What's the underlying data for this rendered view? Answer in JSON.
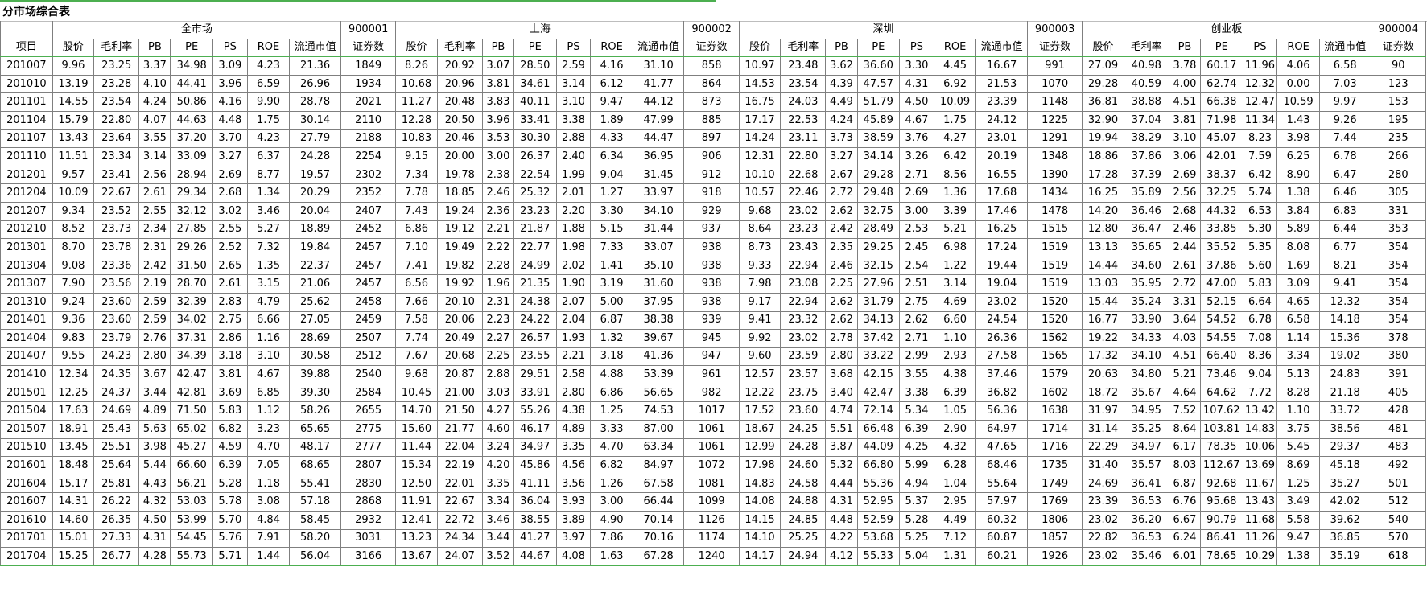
{
  "title": "分市场综合表",
  "groups": [
    {
      "name": "全市场",
      "code": "900001"
    },
    {
      "name": "上海",
      "code": "900002"
    },
    {
      "name": "深圳",
      "code": "900003"
    },
    {
      "name": "创业板",
      "code": "900004"
    }
  ],
  "row_header": "项目",
  "columns": [
    "股价",
    "毛利率",
    "PB",
    "PE",
    "PS",
    "ROE",
    "流通市值",
    "证券数"
  ],
  "rows": [
    [
      "201007",
      "9.96",
      "23.25",
      "3.37",
      "34.98",
      "3.09",
      "4.23",
      "21.36",
      "1849",
      "8.26",
      "20.92",
      "3.07",
      "28.50",
      "2.59",
      "4.16",
      "31.10",
      "858",
      "10.97",
      "23.48",
      "3.62",
      "36.60",
      "3.30",
      "4.45",
      "16.67",
      "991",
      "27.09",
      "40.98",
      "3.78",
      "60.17",
      "11.96",
      "4.06",
      "6.58",
      "90"
    ],
    [
      "201010",
      "13.19",
      "23.28",
      "4.10",
      "44.41",
      "3.96",
      "6.59",
      "26.96",
      "1934",
      "10.68",
      "20.96",
      "3.81",
      "34.61",
      "3.14",
      "6.12",
      "41.77",
      "864",
      "14.53",
      "23.54",
      "4.39",
      "47.57",
      "4.31",
      "6.92",
      "21.53",
      "1070",
      "29.28",
      "40.59",
      "4.00",
      "62.74",
      "12.32",
      "0.00",
      "7.03",
      "123"
    ],
    [
      "201101",
      "14.55",
      "23.54",
      "4.24",
      "50.86",
      "4.16",
      "9.90",
      "28.78",
      "2021",
      "11.27",
      "20.48",
      "3.83",
      "40.11",
      "3.10",
      "9.47",
      "44.12",
      "873",
      "16.75",
      "24.03",
      "4.49",
      "51.79",
      "4.50",
      "10.09",
      "23.39",
      "1148",
      "36.81",
      "38.88",
      "4.51",
      "66.38",
      "12.47",
      "10.59",
      "9.97",
      "153"
    ],
    [
      "201104",
      "15.79",
      "22.80",
      "4.07",
      "44.63",
      "4.48",
      "1.75",
      "30.14",
      "2110",
      "12.28",
      "20.50",
      "3.96",
      "33.41",
      "3.38",
      "1.89",
      "47.99",
      "885",
      "17.17",
      "22.53",
      "4.24",
      "45.89",
      "4.67",
      "1.75",
      "24.12",
      "1225",
      "32.90",
      "37.04",
      "3.81",
      "71.98",
      "11.34",
      "1.43",
      "9.26",
      "195"
    ],
    [
      "201107",
      "13.43",
      "23.64",
      "3.55",
      "37.20",
      "3.70",
      "4.23",
      "27.79",
      "2188",
      "10.83",
      "20.46",
      "3.53",
      "30.30",
      "2.88",
      "4.33",
      "44.47",
      "897",
      "14.24",
      "23.11",
      "3.73",
      "38.59",
      "3.76",
      "4.27",
      "23.01",
      "1291",
      "19.94",
      "38.29",
      "3.10",
      "45.07",
      "8.23",
      "3.98",
      "7.44",
      "235"
    ],
    [
      "201110",
      "11.51",
      "23.34",
      "3.14",
      "33.09",
      "3.27",
      "6.37",
      "24.28",
      "2254",
      "9.15",
      "20.00",
      "3.00",
      "26.37",
      "2.40",
      "6.34",
      "36.95",
      "906",
      "12.31",
      "22.80",
      "3.27",
      "34.14",
      "3.26",
      "6.42",
      "20.19",
      "1348",
      "18.86",
      "37.86",
      "3.06",
      "42.01",
      "7.59",
      "6.25",
      "6.78",
      "266"
    ],
    [
      "201201",
      "9.57",
      "23.41",
      "2.56",
      "28.94",
      "2.69",
      "8.77",
      "19.57",
      "2302",
      "7.34",
      "19.78",
      "2.38",
      "22.54",
      "1.99",
      "9.04",
      "31.45",
      "912",
      "10.10",
      "22.68",
      "2.67",
      "29.28",
      "2.71",
      "8.56",
      "16.55",
      "1390",
      "17.28",
      "37.39",
      "2.69",
      "38.37",
      "6.42",
      "8.90",
      "6.47",
      "280"
    ],
    [
      "201204",
      "10.09",
      "22.67",
      "2.61",
      "29.34",
      "2.68",
      "1.34",
      "20.29",
      "2352",
      "7.78",
      "18.85",
      "2.46",
      "25.32",
      "2.01",
      "1.27",
      "33.97",
      "918",
      "10.57",
      "22.46",
      "2.72",
      "29.48",
      "2.69",
      "1.36",
      "17.68",
      "1434",
      "16.25",
      "35.89",
      "2.56",
      "32.25",
      "5.74",
      "1.38",
      "6.46",
      "305"
    ],
    [
      "201207",
      "9.34",
      "23.52",
      "2.55",
      "32.12",
      "3.02",
      "3.46",
      "20.04",
      "2407",
      "7.43",
      "19.24",
      "2.36",
      "23.23",
      "2.20",
      "3.30",
      "34.10",
      "929",
      "9.68",
      "23.02",
      "2.62",
      "32.75",
      "3.00",
      "3.39",
      "17.46",
      "1478",
      "14.20",
      "36.46",
      "2.68",
      "44.32",
      "6.53",
      "3.84",
      "6.83",
      "331"
    ],
    [
      "201210",
      "8.52",
      "23.73",
      "2.34",
      "27.85",
      "2.55",
      "5.27",
      "18.89",
      "2452",
      "6.86",
      "19.12",
      "2.21",
      "21.87",
      "1.88",
      "5.15",
      "31.44",
      "937",
      "8.64",
      "23.23",
      "2.42",
      "28.49",
      "2.53",
      "5.21",
      "16.25",
      "1515",
      "12.80",
      "36.47",
      "2.46",
      "33.85",
      "5.30",
      "5.89",
      "6.44",
      "353"
    ],
    [
      "201301",
      "8.70",
      "23.78",
      "2.31",
      "29.26",
      "2.52",
      "7.32",
      "19.84",
      "2457",
      "7.10",
      "19.49",
      "2.22",
      "22.77",
      "1.98",
      "7.33",
      "33.07",
      "938",
      "8.73",
      "23.43",
      "2.35",
      "29.25",
      "2.45",
      "6.98",
      "17.24",
      "1519",
      "13.13",
      "35.65",
      "2.44",
      "35.52",
      "5.35",
      "8.08",
      "6.77",
      "354"
    ],
    [
      "201304",
      "9.08",
      "23.36",
      "2.42",
      "31.50",
      "2.65",
      "1.35",
      "22.37",
      "2457",
      "7.41",
      "19.82",
      "2.28",
      "24.99",
      "2.02",
      "1.41",
      "35.10",
      "938",
      "9.33",
      "22.94",
      "2.46",
      "32.15",
      "2.54",
      "1.22",
      "19.44",
      "1519",
      "14.44",
      "34.60",
      "2.61",
      "37.86",
      "5.60",
      "1.69",
      "8.21",
      "354"
    ],
    [
      "201307",
      "7.90",
      "23.56",
      "2.19",
      "28.70",
      "2.61",
      "3.15",
      "21.06",
      "2457",
      "6.56",
      "19.92",
      "1.96",
      "21.35",
      "1.90",
      "3.19",
      "31.60",
      "938",
      "7.98",
      "23.08",
      "2.25",
      "27.96",
      "2.51",
      "3.14",
      "19.04",
      "1519",
      "13.03",
      "35.95",
      "2.72",
      "47.00",
      "5.83",
      "3.09",
      "9.41",
      "354"
    ],
    [
      "201310",
      "9.24",
      "23.60",
      "2.59",
      "32.39",
      "2.83",
      "4.79",
      "25.62",
      "2458",
      "7.66",
      "20.10",
      "2.31",
      "24.38",
      "2.07",
      "5.00",
      "37.95",
      "938",
      "9.17",
      "22.94",
      "2.62",
      "31.79",
      "2.75",
      "4.69",
      "23.02",
      "1520",
      "15.44",
      "35.24",
      "3.31",
      "52.15",
      "6.64",
      "4.65",
      "12.32",
      "354"
    ],
    [
      "201401",
      "9.36",
      "23.60",
      "2.59",
      "34.02",
      "2.75",
      "6.66",
      "27.05",
      "2459",
      "7.58",
      "20.06",
      "2.23",
      "24.22",
      "2.04",
      "6.87",
      "38.38",
      "939",
      "9.41",
      "23.32",
      "2.62",
      "34.13",
      "2.62",
      "6.60",
      "24.54",
      "1520",
      "16.77",
      "33.90",
      "3.64",
      "54.52",
      "6.78",
      "6.58",
      "14.18",
      "354"
    ],
    [
      "201404",
      "9.83",
      "23.79",
      "2.76",
      "37.31",
      "2.86",
      "1.16",
      "28.69",
      "2507",
      "7.74",
      "20.49",
      "2.27",
      "26.57",
      "1.93",
      "1.32",
      "39.67",
      "945",
      "9.92",
      "23.02",
      "2.78",
      "37.42",
      "2.71",
      "1.10",
      "26.36",
      "1562",
      "19.22",
      "34.33",
      "4.03",
      "54.55",
      "7.08",
      "1.14",
      "15.36",
      "378"
    ],
    [
      "201407",
      "9.55",
      "24.23",
      "2.80",
      "34.39",
      "3.18",
      "3.10",
      "30.58",
      "2512",
      "7.67",
      "20.68",
      "2.25",
      "23.55",
      "2.21",
      "3.18",
      "41.36",
      "947",
      "9.60",
      "23.59",
      "2.80",
      "33.22",
      "2.99",
      "2.93",
      "27.58",
      "1565",
      "17.32",
      "34.10",
      "4.51",
      "66.40",
      "8.36",
      "3.34",
      "19.02",
      "380"
    ],
    [
      "201410",
      "12.34",
      "24.35",
      "3.67",
      "42.47",
      "3.81",
      "4.67",
      "39.88",
      "2540",
      "9.68",
      "20.87",
      "2.88",
      "29.51",
      "2.58",
      "4.88",
      "53.39",
      "961",
      "12.57",
      "23.57",
      "3.68",
      "42.15",
      "3.55",
      "4.38",
      "37.46",
      "1579",
      "20.63",
      "34.80",
      "5.21",
      "73.46",
      "9.04",
      "5.13",
      "24.83",
      "391"
    ],
    [
      "201501",
      "12.25",
      "24.37",
      "3.44",
      "42.81",
      "3.69",
      "6.85",
      "39.30",
      "2584",
      "10.45",
      "21.00",
      "3.03",
      "33.91",
      "2.80",
      "6.86",
      "56.65",
      "982",
      "12.22",
      "23.75",
      "3.40",
      "42.47",
      "3.38",
      "6.39",
      "36.82",
      "1602",
      "18.72",
      "35.67",
      "4.64",
      "64.62",
      "7.72",
      "8.28",
      "21.18",
      "405"
    ],
    [
      "201504",
      "17.63",
      "24.69",
      "4.89",
      "71.50",
      "5.83",
      "1.12",
      "58.26",
      "2655",
      "14.70",
      "21.50",
      "4.27",
      "55.26",
      "4.38",
      "1.25",
      "74.53",
      "1017",
      "17.52",
      "23.60",
      "4.74",
      "72.14",
      "5.34",
      "1.05",
      "56.36",
      "1638",
      "31.97",
      "34.95",
      "7.52",
      "107.62",
      "13.42",
      "1.10",
      "33.72",
      "428"
    ],
    [
      "201507",
      "18.91",
      "25.43",
      "5.63",
      "65.02",
      "6.82",
      "3.23",
      "65.65",
      "2775",
      "15.60",
      "21.77",
      "4.60",
      "46.17",
      "4.89",
      "3.33",
      "87.00",
      "1061",
      "18.67",
      "24.25",
      "5.51",
      "66.48",
      "6.39",
      "2.90",
      "64.97",
      "1714",
      "31.14",
      "35.25",
      "8.64",
      "103.81",
      "14.83",
      "3.75",
      "38.56",
      "481"
    ],
    [
      "201510",
      "13.45",
      "25.51",
      "3.98",
      "45.27",
      "4.59",
      "4.70",
      "48.17",
      "2777",
      "11.44",
      "22.04",
      "3.24",
      "34.97",
      "3.35",
      "4.70",
      "63.34",
      "1061",
      "12.99",
      "24.28",
      "3.87",
      "44.09",
      "4.25",
      "4.32",
      "47.65",
      "1716",
      "22.29",
      "34.97",
      "6.17",
      "78.35",
      "10.06",
      "5.45",
      "29.37",
      "483"
    ],
    [
      "201601",
      "18.48",
      "25.64",
      "5.44",
      "66.60",
      "6.39",
      "7.05",
      "68.65",
      "2807",
      "15.34",
      "22.19",
      "4.20",
      "45.86",
      "4.56",
      "6.82",
      "84.97",
      "1072",
      "17.98",
      "24.60",
      "5.32",
      "66.80",
      "5.99",
      "6.28",
      "68.46",
      "1735",
      "31.40",
      "35.57",
      "8.03",
      "112.67",
      "13.69",
      "8.69",
      "45.18",
      "492"
    ],
    [
      "201604",
      "15.17",
      "25.81",
      "4.43",
      "56.21",
      "5.28",
      "1.18",
      "55.41",
      "2830",
      "12.50",
      "22.01",
      "3.35",
      "41.11",
      "3.56",
      "1.26",
      "67.58",
      "1081",
      "14.83",
      "24.58",
      "4.44",
      "55.36",
      "4.94",
      "1.04",
      "55.64",
      "1749",
      "24.69",
      "36.41",
      "6.87",
      "92.68",
      "11.67",
      "1.25",
      "35.27",
      "501"
    ],
    [
      "201607",
      "14.31",
      "26.22",
      "4.32",
      "53.03",
      "5.78",
      "3.08",
      "57.18",
      "2868",
      "11.91",
      "22.67",
      "3.34",
      "36.04",
      "3.93",
      "3.00",
      "66.44",
      "1099",
      "14.08",
      "24.88",
      "4.31",
      "52.95",
      "5.37",
      "2.95",
      "57.97",
      "1769",
      "23.39",
      "36.53",
      "6.76",
      "95.68",
      "13.43",
      "3.49",
      "42.02",
      "512"
    ],
    [
      "201610",
      "14.60",
      "26.35",
      "4.50",
      "53.99",
      "5.70",
      "4.84",
      "58.45",
      "2932",
      "12.41",
      "22.72",
      "3.46",
      "38.55",
      "3.89",
      "4.90",
      "70.14",
      "1126",
      "14.15",
      "24.85",
      "4.48",
      "52.59",
      "5.28",
      "4.49",
      "60.32",
      "1806",
      "23.02",
      "36.20",
      "6.67",
      "90.79",
      "11.68",
      "5.58",
      "39.62",
      "540"
    ],
    [
      "201701",
      "15.01",
      "27.33",
      "4.31",
      "54.45",
      "5.76",
      "7.91",
      "58.20",
      "3031",
      "13.23",
      "24.34",
      "3.44",
      "41.27",
      "3.97",
      "7.86",
      "70.16",
      "1174",
      "14.10",
      "25.25",
      "4.22",
      "53.68",
      "5.25",
      "7.12",
      "60.87",
      "1857",
      "22.82",
      "36.53",
      "6.24",
      "86.41",
      "11.26",
      "9.47",
      "36.85",
      "570"
    ],
    [
      "201704",
      "15.25",
      "26.77",
      "4.28",
      "55.73",
      "5.71",
      "1.44",
      "56.04",
      "3166",
      "13.67",
      "24.07",
      "3.52",
      "44.67",
      "4.08",
      "1.63",
      "67.28",
      "1240",
      "14.17",
      "24.94",
      "4.12",
      "55.33",
      "5.04",
      "1.31",
      "60.21",
      "1926",
      "23.02",
      "35.46",
      "6.01",
      "78.65",
      "10.29",
      "1.38",
      "35.19",
      "618"
    ]
  ]
}
